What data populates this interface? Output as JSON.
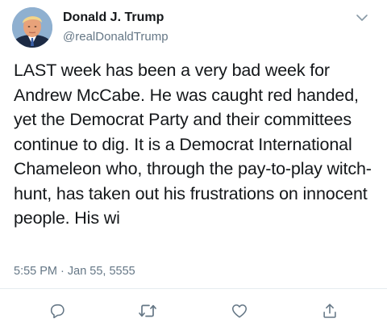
{
  "tweet": {
    "author_name": "Donald J. Trump",
    "author_handle": "@realDonaldTrump",
    "text": "LAST week has been a very bad week for Andrew McCabe. He was caught red handed, yet the Democrat Party and their committees continue to dig. It is a Democrat International Chameleon who, through the pay-to-play witch-hunt, has taken out his frustrations on innocent people. His wi",
    "timestamp": "5:55 PM · Jan 55, 5555"
  },
  "icons": {
    "menu": "chevron-down-icon",
    "reply": "reply-icon",
    "retweet": "retweet-icon",
    "like": "heart-icon",
    "share": "share-icon"
  },
  "colors": {
    "text": "#14171a",
    "secondary": "#657786",
    "icon": "#657786",
    "divider": "#e6ecf0"
  }
}
